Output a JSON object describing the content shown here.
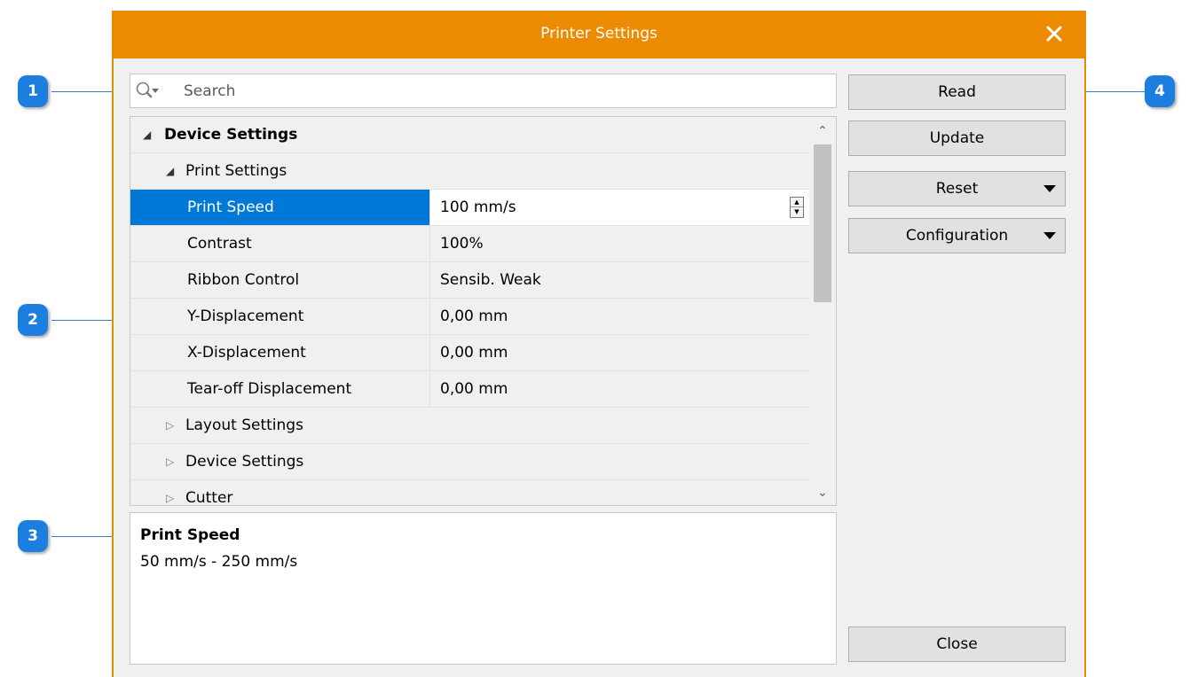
{
  "window": {
    "title": "Printer Settings",
    "accent_color": "#ec8b00",
    "close_icon": "close-icon"
  },
  "search": {
    "placeholder": "Search",
    "icon": "search-icon"
  },
  "property_grid": {
    "categories": [
      {
        "label": "Device Settings",
        "expanded": true
      }
    ],
    "subcategories": [
      {
        "label": "Print Settings",
        "expanded": true
      },
      {
        "label": "Layout Settings",
        "expanded": false
      },
      {
        "label": "Device Settings",
        "expanded": false
      },
      {
        "label": "Cutter",
        "expanded": false
      }
    ],
    "properties": [
      {
        "name": "Print Speed",
        "value": "100  mm/s",
        "selected": true
      },
      {
        "name": "Contrast",
        "value": "100%"
      },
      {
        "name": "Ribbon Control",
        "value": "Sensib. Weak"
      },
      {
        "name": "Y-Displacement",
        "value": "0,00  mm"
      },
      {
        "name": "X-Displacement",
        "value": "0,00  mm"
      },
      {
        "name": "Tear-off Displacement",
        "value": "0,00  mm"
      }
    ],
    "selection_color": "#0078d7"
  },
  "description": {
    "title": "Print Speed",
    "text": "50  mm/s - 250  mm/s"
  },
  "buttons": {
    "read": "Read",
    "update": "Update",
    "reset": "Reset",
    "configuration": "Configuration",
    "close": "Close"
  },
  "callouts": [
    "1",
    "2",
    "3",
    "4"
  ],
  "callout_color": "#1c7fe0"
}
